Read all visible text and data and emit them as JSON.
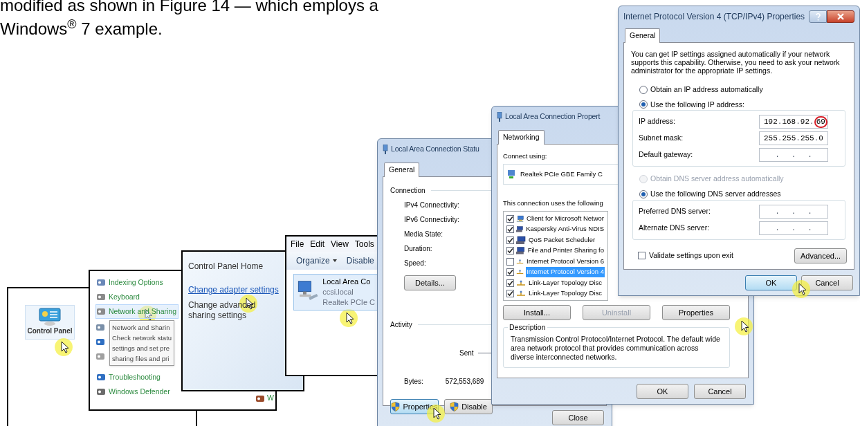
{
  "document": {
    "lines": [
      "modified as shown in Figure 14 — which employs a",
      "Windows$^{®}$ 7 example."
    ]
  },
  "desktop": {
    "icon_label": "Control Panel"
  },
  "control_panel": {
    "items": [
      {
        "label": "Indexing Options",
        "selected": false
      },
      {
        "label": "Keyboard",
        "selected": false
      },
      {
        "label": "Network and Sharing",
        "selected": true
      }
    ],
    "tooltip": [
      "Network and Sharin",
      "Check network statu",
      "settings and set pre",
      "sharing files and pri"
    ],
    "items_below": [
      {
        "label": "Troubleshooting",
        "selected": false
      },
      {
        "label": "Windows Defender",
        "selected": false
      }
    ],
    "right_item": "W"
  },
  "tasks": {
    "home": "Control Panel Home",
    "links": [
      {
        "label": "Change adapter settings",
        "kind": "link"
      },
      {
        "label": "Change advanced sharing settings",
        "kind": "text"
      }
    ]
  },
  "network_connections": {
    "menu": [
      "File",
      "Edit",
      "View",
      "Tools"
    ],
    "toolbar": [
      {
        "label": "Organize",
        "dropdown": true
      },
      {
        "label": "Disable",
        "dropdown": false
      }
    ],
    "connection": {
      "name": "Local Area Co",
      "domain": "ccsi.local",
      "adapter": "Realtek PCIe C",
      "selected": true
    }
  },
  "status_window": {
    "title": "Local Area Connection Statu",
    "tabs": [
      {
        "label": "General",
        "selected": true
      }
    ],
    "connection_group": "Connection",
    "fields": [
      "IPv4 Connectivity:",
      "IPv6 Connectivity:",
      "Media State:",
      "Duration:",
      "Speed:"
    ],
    "details_button": "Details...",
    "activity_group": "Activity",
    "sent": "Sent",
    "bytes_label": "Bytes:",
    "bytes_sent": "572,553,689",
    "buttons": [
      {
        "label": "Properties",
        "shield": true
      },
      {
        "label": "Disable",
        "shield": true
      }
    ],
    "close_button": "Close"
  },
  "properties_window": {
    "title": "Local Area Connection Propert",
    "tabs": [
      {
        "label": "Networking",
        "selected": true
      }
    ],
    "connect_using_label": "Connect using:",
    "adapter": "Realtek PCIe GBE Family C",
    "components_label": "This connection uses the following",
    "components": [
      {
        "label": "Client for Microsoft Networ",
        "checked": true,
        "selected": false,
        "kind": "client"
      },
      {
        "label": "Kaspersky Anti-Virus NDIS",
        "checked": true,
        "selected": false,
        "kind": "service"
      },
      {
        "label": "QoS Packet Scheduler",
        "checked": true,
        "selected": false,
        "kind": "service"
      },
      {
        "label": "File and Printer Sharing fo",
        "checked": true,
        "selected": false,
        "kind": "service"
      },
      {
        "label": "Internet Protocol Version 6",
        "checked": false,
        "selected": false,
        "kind": "protocol"
      },
      {
        "label": "Internet Protocol Version 4",
        "checked": true,
        "selected": true,
        "kind": "protocol"
      },
      {
        "label": "Link-Layer Topology Disc",
        "checked": true,
        "selected": false,
        "kind": "protocol"
      },
      {
        "label": "Link-Layer Topology Disc",
        "checked": true,
        "selected": false,
        "kind": "protocol"
      }
    ],
    "buttons": [
      {
        "label": "Install...",
        "disabled": false
      },
      {
        "label": "Uninstall",
        "disabled": true
      },
      {
        "label": "Properties",
        "disabled": false
      }
    ],
    "description_group": "Description",
    "description": "Transmission Control Protocol/Internet Protocol. The default wide area network protocol that provides communication across diverse interconnected networks.",
    "ok": "OK",
    "cancel": "Cancel"
  },
  "ipv4_window": {
    "title": "Internet Protocol Version 4 (TCP/IPv4) Properties",
    "tabs": [
      {
        "label": "General",
        "selected": true
      }
    ],
    "intro": "You can get IP settings assigned automatically if your network supports this capability. Otherwise, you need to ask your network administrator for the appropriate IP settings.",
    "separator": ".",
    "ip_radios": [
      {
        "label": "Obtain an IP address automatically",
        "selected": false,
        "disabled": false
      },
      {
        "label": "Use the following IP address:",
        "selected": true,
        "disabled": false
      }
    ],
    "ip_fields": [
      {
        "label": "IP address:",
        "octets": [
          {
            "text": "192",
            "circled": false
          },
          {
            "text": "168",
            "circled": false
          },
          {
            "text": "92",
            "circled": false
          },
          {
            "text": "69",
            "circled": true
          }
        ]
      },
      {
        "label": "Subnet mask:",
        "octets": [
          {
            "text": "255",
            "circled": false
          },
          {
            "text": "255",
            "circled": false
          },
          {
            "text": "255",
            "circled": false
          },
          {
            "text": "0",
            "circled": false
          }
        ]
      },
      {
        "label": "Default gateway:"
      }
    ],
    "dns_radios": [
      {
        "label": "Obtain DNS server address automatically",
        "selected": false,
        "disabled": true
      },
      {
        "label": "Use the following DNS server addresses",
        "selected": true,
        "disabled": false
      }
    ],
    "dns_fields": [
      {
        "label": "Preferred DNS server:"
      },
      {
        "label": "Alternate DNS server:"
      }
    ],
    "validate": {
      "label": "Validate settings upon exit",
      "checked": false
    },
    "advanced_button": "Advanced...",
    "ok": "OK",
    "cancel": "Cancel"
  }
}
